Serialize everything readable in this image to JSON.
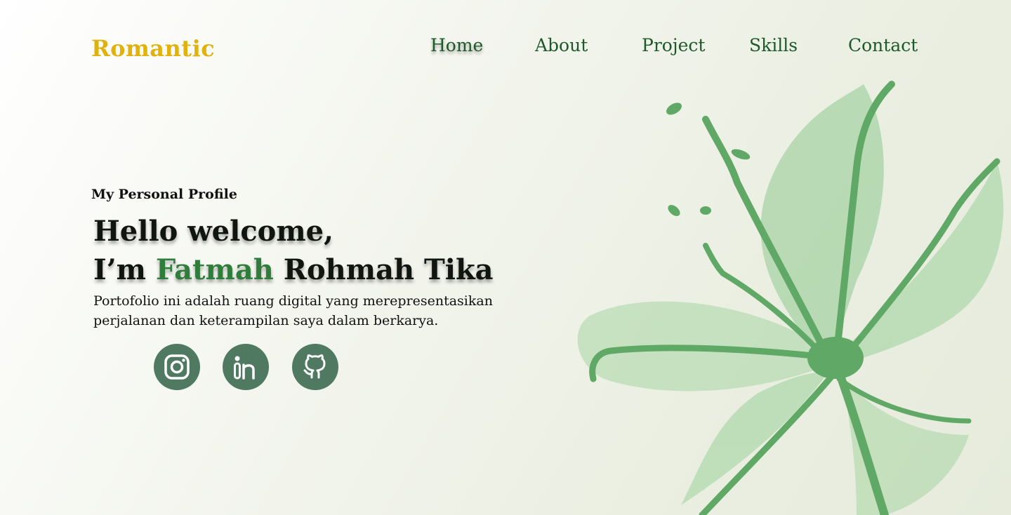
{
  "brand": {
    "logo_text": "Romantic",
    "logo_color": "#e2b20c"
  },
  "nav": {
    "active": "Home",
    "items": [
      {
        "label": "Home"
      },
      {
        "label": "About"
      },
      {
        "label": "Project"
      },
      {
        "label": "Skills"
      },
      {
        "label": "Contact"
      }
    ]
  },
  "hero": {
    "subtitle": "My Personal Profile",
    "greeting": "Hello welcome,",
    "intro_prefix": "I’m ",
    "name_highlight": "Fatmah",
    "name_rest": " Rohmah Tika",
    "description_line1": "Portofolio ini adalah ruang digital yang merepresentasikan",
    "description_line2": "perjalanan dan keterampilan saya dalam berkarya."
  },
  "social": [
    {
      "icon": "instagram-icon"
    },
    {
      "icon": "linkedin-icon"
    },
    {
      "icon": "github-icon"
    }
  ],
  "colors": {
    "nav_text": "#1d5a2a",
    "accent_green": "#2e7d3a",
    "social_bg": "#4f7a61",
    "flower_green": "#5fa865"
  }
}
